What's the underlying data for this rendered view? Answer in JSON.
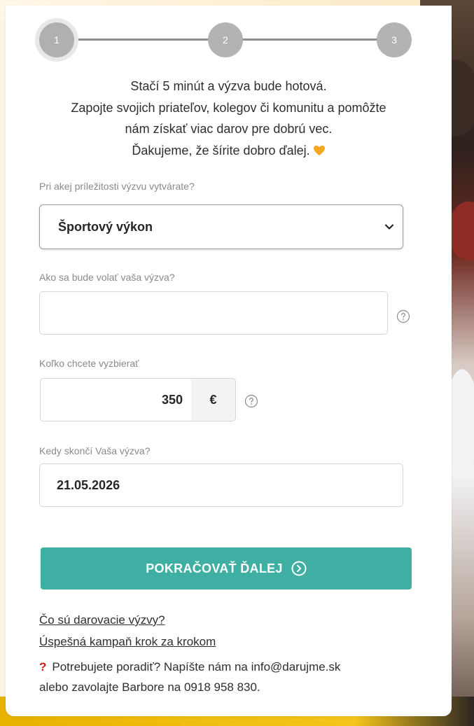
{
  "stepper": {
    "steps": [
      "1",
      "2",
      "3"
    ],
    "active_step": 1
  },
  "intro": {
    "line1": "Stačí 5 minút a výzva bude hotová.",
    "line2": "Zapojte svojich priateľov, kolegov či komunitu a pomôžte",
    "line3": "nám získať viac darov pre dobrú vec.",
    "line4": "Ďakujeme, že šírite dobro ďalej."
  },
  "occasion": {
    "label": "Pri akej príležitosti výzvu vytvárate?",
    "selected": "Športový výkon"
  },
  "name": {
    "label": "Ako sa bude volať vaša výzva?",
    "value": ""
  },
  "goal": {
    "label": "Koľko chcete vyzbierať",
    "value": "350",
    "currency": "€"
  },
  "end_date": {
    "label": "Kedy skončí Vaša výzva?",
    "value": "21.05.2026"
  },
  "continue_button": "POKRAČOVAŤ ĎALEJ",
  "links": {
    "what_are": "Čo sú darovacie výzvy?",
    "success": "Úspešná kampaň krok za krokom"
  },
  "help": {
    "line1": "Potrebujete poradiť? Napíšte nám na info@darujme.sk",
    "line2": "alebo zavolajte Barbore na 0918 958 830."
  },
  "colors": {
    "primary": "#3fafa3",
    "step": "#b3b3b3",
    "accent_red": "#d11a1a",
    "heart": "#f5a623"
  }
}
